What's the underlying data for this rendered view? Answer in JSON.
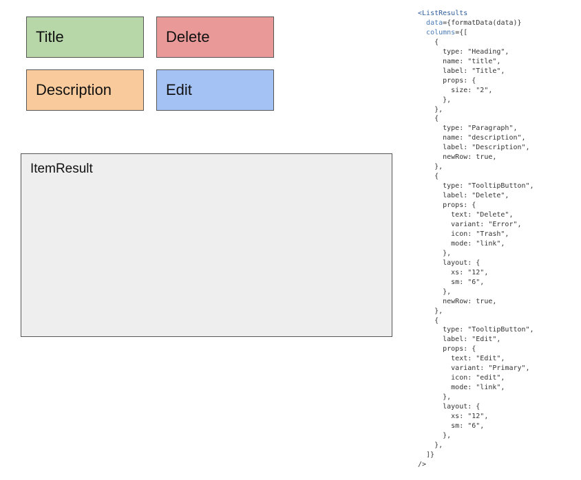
{
  "boxes": {
    "title": "Title",
    "delete": "Delete",
    "description": "Description",
    "edit": "Edit",
    "item_result": "ItemResult"
  },
  "code": {
    "open_tag": "ListResults",
    "data_attr": "data",
    "data_value": "{formatData(data)}",
    "columns_attr": "columns",
    "columns_open": "={[",
    "body": "    {\n      type: \"Heading\",\n      name: \"title\",\n      label: \"Title\",\n      props: {\n        size: \"2\",\n      },\n    },\n    {\n      type: \"Paragraph\",\n      name: \"description\",\n      label: \"Description\",\n      newRow: true,\n    },\n    {\n      type: \"TooltipButton\",\n      label: \"Delete\",\n      props: {\n        text: \"Delete\",\n        variant: \"Error\",\n        icon: \"Trash\",\n        mode: \"link\",\n      },\n      layout: {\n        xs: \"12\",\n        sm: \"6\",\n      },\n      newRow: true,\n    },\n    {\n      type: \"TooltipButton\",\n      label: \"Edit\",\n      props: {\n        text: \"Edit\",\n        variant: \"Primary\",\n        icon: \"edit\",\n        mode: \"link\",\n      },\n      layout: {\n        xs: \"12\",\n        sm: \"6\",\n      },\n    },\n  ]}\n/>"
  }
}
